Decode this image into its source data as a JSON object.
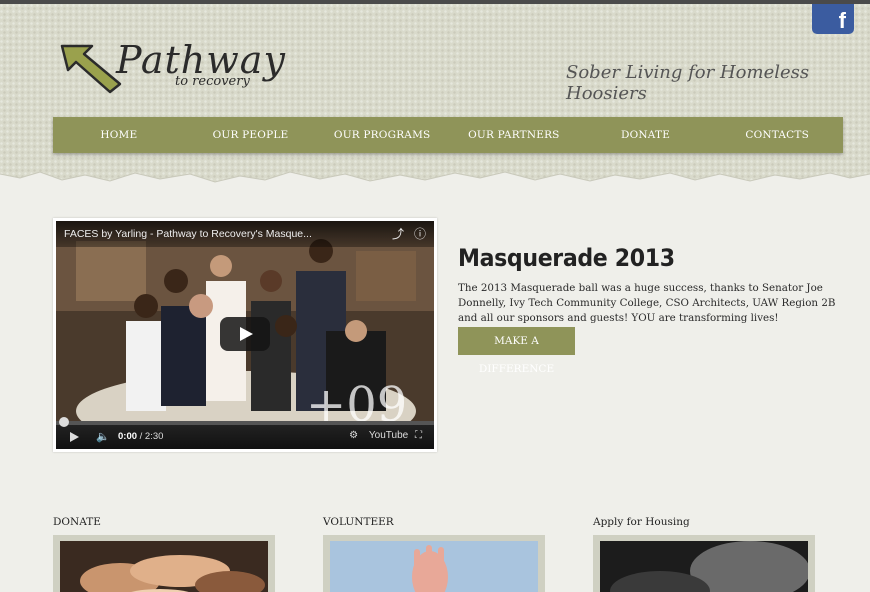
{
  "social": {
    "facebook_icon": "facebook-icon",
    "facebook_glyph": "f"
  },
  "logo": {
    "title": "Pathway",
    "subtitle": "to recovery",
    "icon": "arrow-icon"
  },
  "tagline": "Sober Living for Homeless Hoosiers",
  "nav": {
    "items": [
      "HOME",
      "OUR PEOPLE",
      "OUR PROGRAMS",
      "OUR PARTNERS",
      "DONATE",
      "CONTACTS"
    ]
  },
  "video": {
    "title": "FACES by Yarling - Pathway to Recovery's Masque...",
    "share_icon": "share-icon",
    "info_icon": "info-icon",
    "time_current": "0:00",
    "time_total": "/ 2:30",
    "youtube_label": "YouTube"
  },
  "feature": {
    "headline": "Masquerade 2013",
    "body": "The 2013 Masquerade ball was a huge success, thanks to Senator Joe Donnelly,  Ivy Tech Community College, CSO Architects, UAW Region 2B and all our sponsors and guests!  YOU are transforming lives!",
    "cta_label": "MAKE A DIFFERENCE"
  },
  "cards": [
    {
      "label": "DONATE"
    },
    {
      "label": "VOLUNTEER"
    },
    {
      "label": "Apply for Housing"
    }
  ],
  "colors": {
    "accent_olive": "#8f9459",
    "facebook_blue": "#3b5ca0",
    "header_bg": "#d9dacb",
    "page_bg": "#efefea"
  }
}
